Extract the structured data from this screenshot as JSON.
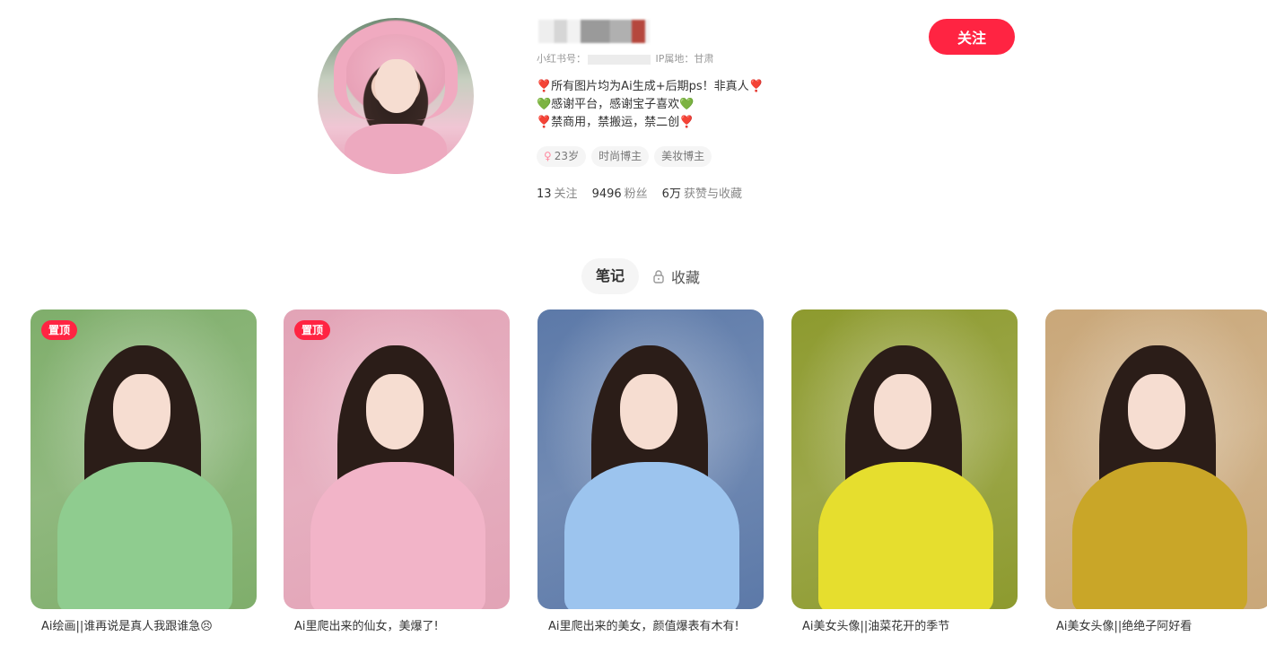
{
  "profile": {
    "name_display": "",
    "id_label": "小红书号：",
    "ip_label": "IP属地：甘肃",
    "bio": [
      "❣️所有图片均为Ai生成+后期ps！非真人❣️",
      "💚感谢平台，感谢宝子喜欢💚",
      "❣️禁商用，禁搬运，禁二创❣️"
    ],
    "tags": [
      {
        "icon": "female-icon",
        "label": "23岁"
      },
      {
        "label": "时尚博主"
      },
      {
        "label": "美妆博主"
      }
    ],
    "stats": {
      "following": "13",
      "following_label": "关注",
      "followers": "9496",
      "followers_label": "粉丝",
      "likes": "6万",
      "likes_label": "获赞与收藏"
    },
    "follow_button": "关注"
  },
  "tabs": {
    "notes": "笔记",
    "collections": "收藏"
  },
  "notes": [
    {
      "pinned": "置顶",
      "title": "Ai绘画||谁再说是真人我跟谁急😣",
      "bg": "#7fae6b",
      "sweater": "#8fcc8f"
    },
    {
      "pinned": "置顶",
      "title": "Ai里爬出来的仙女，美爆了!",
      "bg": "#e2a3b6",
      "sweater": "#f2b4c8"
    },
    {
      "pinned": "",
      "title": "Ai里爬出来的美女，颜值爆表有木有!",
      "bg": "#5c79a8",
      "sweater": "#9cc4ee"
    },
    {
      "pinned": "",
      "title": "Ai美女头像||油菜花开的季节",
      "bg": "#8d9a2e",
      "sweater": "#e6de2e"
    },
    {
      "pinned": "",
      "title": "Ai美女头像||绝绝子阿好看",
      "bg": "#c9a779",
      "sweater": "#c9a628"
    }
  ]
}
